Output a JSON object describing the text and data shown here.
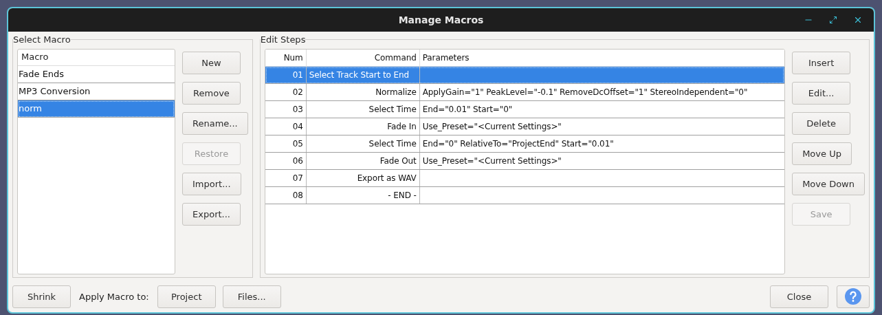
{
  "window": {
    "title": "Manage Macros"
  },
  "select_macro": {
    "title": "Select Macro",
    "column": "Macro",
    "items": [
      {
        "label": "Fade Ends",
        "selected": false
      },
      {
        "label": "MP3 Conversion",
        "selected": false
      },
      {
        "label": "norm",
        "selected": true
      }
    ],
    "buttons": [
      {
        "label": "New",
        "disabled": false
      },
      {
        "label": "Remove",
        "disabled": false
      },
      {
        "label": "Rename...",
        "disabled": false
      },
      {
        "label": "Restore",
        "disabled": true
      },
      {
        "label": "Import...",
        "disabled": false
      },
      {
        "label": "Export...",
        "disabled": false
      }
    ]
  },
  "edit_steps": {
    "title": "Edit Steps",
    "columns": [
      "Num",
      "Command",
      "Parameters"
    ],
    "rows": [
      {
        "num": "01",
        "command": "Select Track Start to End",
        "parameters": "",
        "selected": true
      },
      {
        "num": "02",
        "command": "Normalize",
        "parameters": "ApplyGain=\"1\" PeakLevel=\"-0.1\" RemoveDcOffset=\"1\" StereoIndependent=\"0\"",
        "selected": false
      },
      {
        "num": "03",
        "command": "Select Time",
        "parameters": "End=\"0.01\" Start=\"0\"",
        "selected": false
      },
      {
        "num": "04",
        "command": "Fade In",
        "parameters": "Use_Preset=\"<Current Settings>\"",
        "selected": false
      },
      {
        "num": "05",
        "command": "Select Time",
        "parameters": "End=\"0\" RelativeTo=\"ProjectEnd\" Start=\"0.01\"",
        "selected": false
      },
      {
        "num": "06",
        "command": "Fade Out",
        "parameters": "Use_Preset=\"<Current Settings>\"",
        "selected": false
      },
      {
        "num": "07",
        "command": "Export as WAV",
        "parameters": "",
        "selected": false
      },
      {
        "num": "08",
        "command": "- END -",
        "parameters": "",
        "selected": false
      }
    ],
    "buttons": [
      {
        "label": "Insert",
        "disabled": false
      },
      {
        "label": "Edit...",
        "disabled": false
      },
      {
        "label": "Delete",
        "disabled": false
      },
      {
        "label": "Move Up",
        "disabled": false
      },
      {
        "label": "Move Down",
        "disabled": false
      },
      {
        "label": "Save",
        "disabled": true
      }
    ]
  },
  "bottom_bar": {
    "shrink": "Shrink",
    "apply_label": "Apply Macro to:",
    "apply_buttons": [
      "Project",
      "Files..."
    ],
    "close": "Close"
  }
}
